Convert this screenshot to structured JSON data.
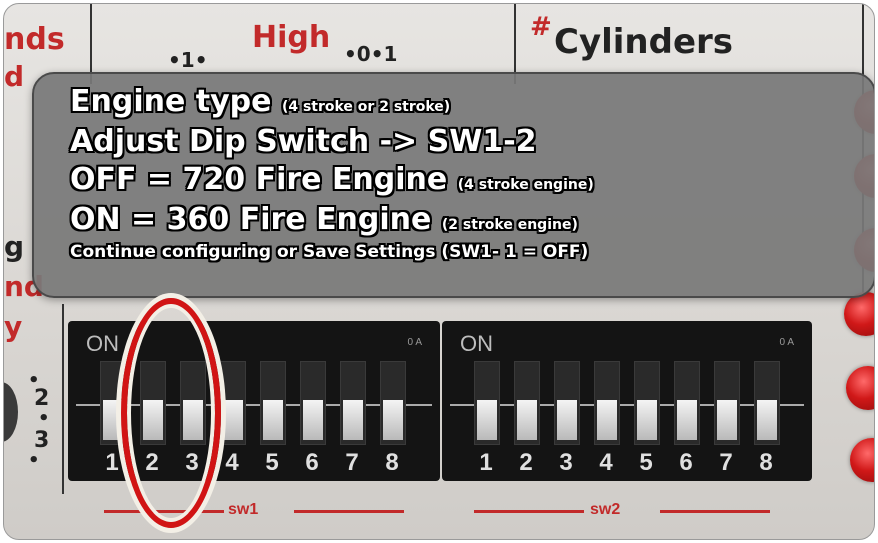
{
  "board": {
    "labels": {
      "high": "High",
      "cylinders": "Cylinders",
      "hash": "#",
      "top_left_frag1": "nds",
      "top_left_frag2": "d",
      "left_frag_g": "g",
      "left_frag_nd": "nd",
      "left_frag_y": "y",
      "dial_1": "•1•",
      "dial_2": "•0•1",
      "left_num_2": "2",
      "left_num_3": "3"
    },
    "sw1": {
      "label": "sw1",
      "on_text": "ON",
      "oa_text": "0 A",
      "numbers": [
        "1",
        "2",
        "3",
        "4",
        "5",
        "6",
        "7",
        "8"
      ]
    },
    "sw2": {
      "label": "sw2",
      "on_text": "ON",
      "oa_text": "0 A",
      "numbers": [
        "1",
        "2",
        "3",
        "4",
        "5",
        "6",
        "7",
        "8"
      ]
    },
    "colors": {
      "board": "#dcd9d5",
      "red_print": "#c22a2a",
      "dip_body": "#141414",
      "highlight": "#d11414"
    }
  },
  "overlay": {
    "line1_main": "Engine type",
    "line1_small": "(4 stroke or 2 stroke)",
    "line2": "Adjust Dip Switch -> SW1-2",
    "line3_main": "OFF = 720 Fire Engine",
    "line3_small": "(4 stroke engine)",
    "line4_main": "ON = 360 Fire Engine",
    "line4_small": "(2 stroke engine)",
    "line5": "Continue configuring or Save Settings (SW1- 1 = OFF)"
  }
}
